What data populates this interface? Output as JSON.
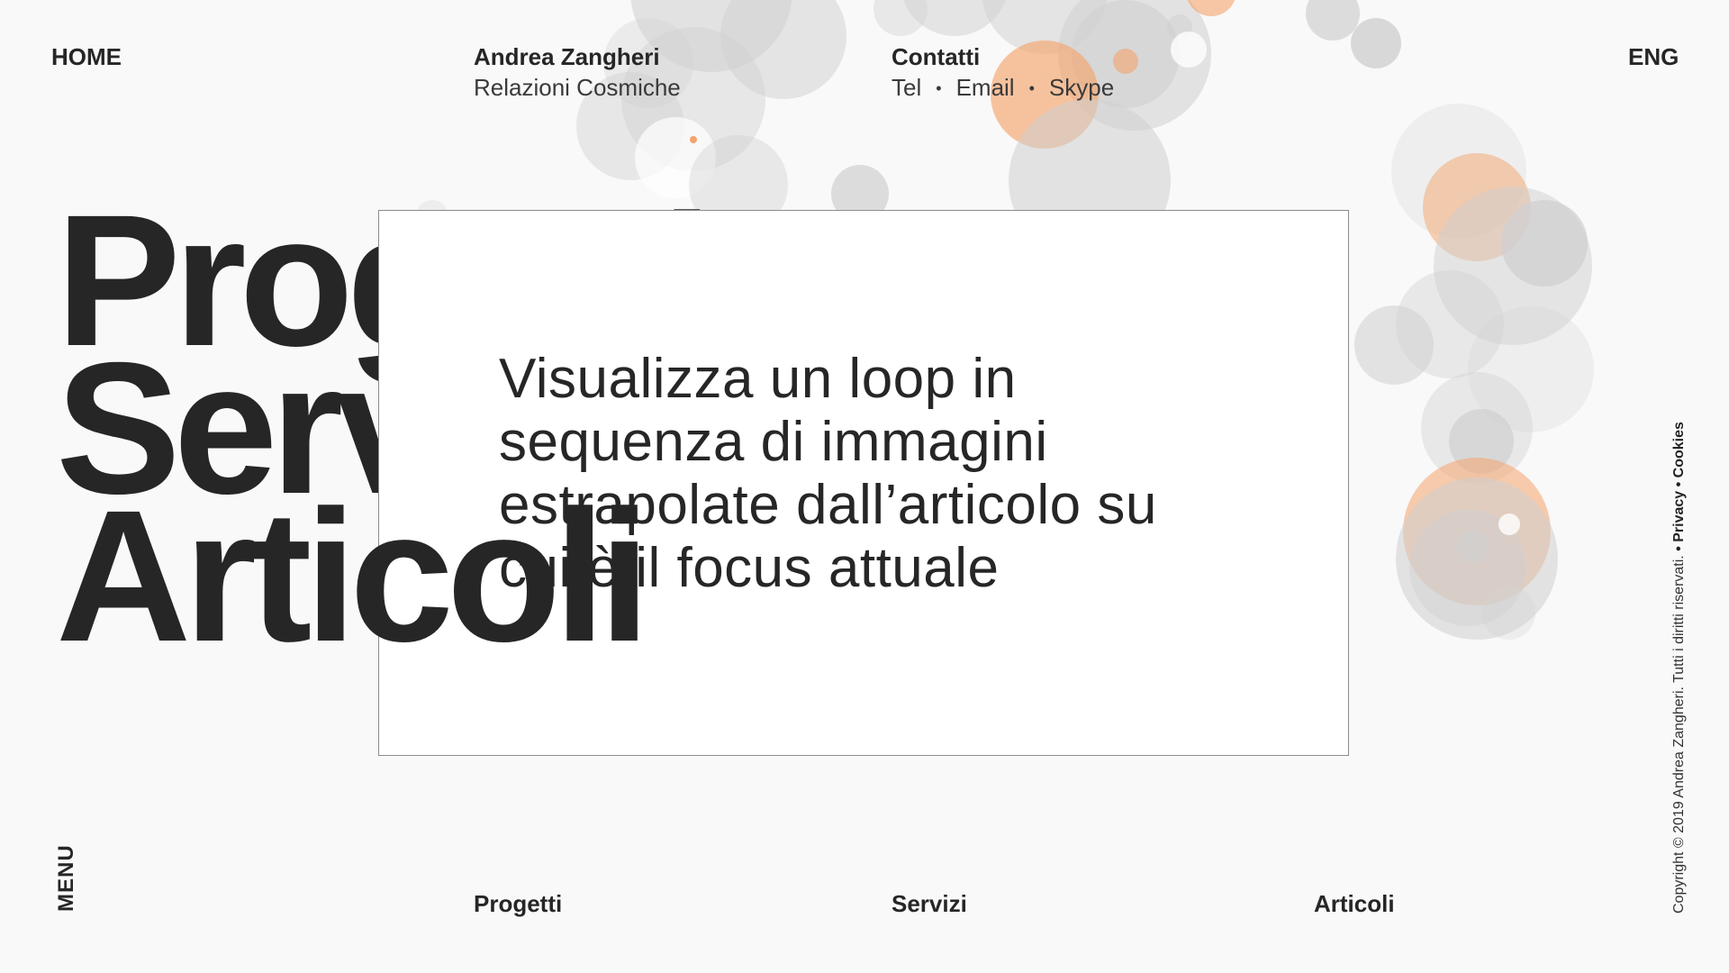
{
  "header": {
    "home_label": "HOME",
    "name": "Andrea Zangheri",
    "subtitle": "Relazioni Cosmiche",
    "contacts_title": "Contatti",
    "contacts": [
      "Tel",
      "Email",
      "Skype"
    ],
    "contact_separator": "•",
    "lang_label": "ENG"
  },
  "hero": {
    "lines": [
      "Progetti",
      "Servizi",
      "Articoli"
    ]
  },
  "overlay": {
    "text": "Visualizza un loop in sequenza di immagini estrapolate dall’articolo su cui è il focus attuale"
  },
  "footer": {
    "menu_label": "MENU",
    "links": [
      "Progetti",
      "Servizi",
      "Articoli"
    ],
    "copyright": "Copyright © 2019 Andrea Zangheri. Tutti i diritti riservati.",
    "privacy_label": "• Privacy",
    "cookies_label": "• Cookies"
  },
  "colors": {
    "accent": "#f4a46c",
    "bubble": "#d0d0d0",
    "text": "#262626",
    "background": "#f9f9f9"
  }
}
